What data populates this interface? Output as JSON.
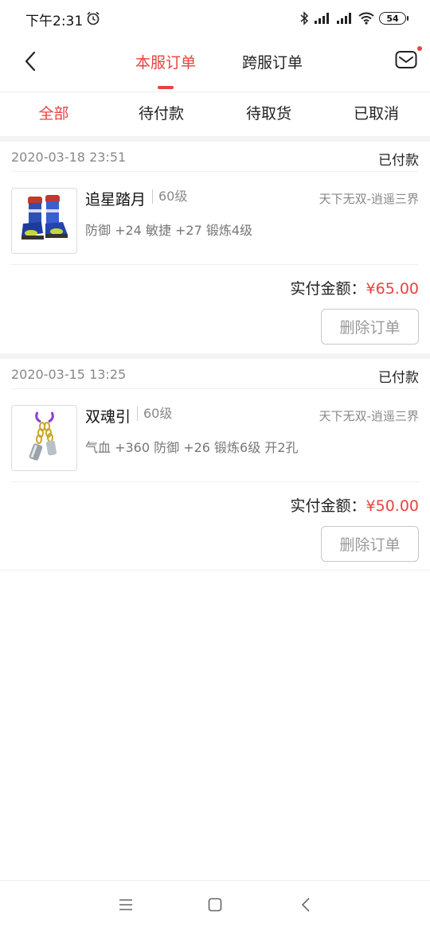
{
  "status_bar": {
    "time": "下午2:31",
    "battery": "54"
  },
  "header": {
    "tabs": [
      {
        "label": "本服订单",
        "active": true
      },
      {
        "label": "跨服订单",
        "active": false
      }
    ]
  },
  "filters": [
    {
      "label": "全部",
      "active": true
    },
    {
      "label": "待付款",
      "active": false
    },
    {
      "label": "待取货",
      "active": false
    },
    {
      "label": "已取消",
      "active": false
    }
  ],
  "orders": [
    {
      "date": "2020-03-18 23:51",
      "status": "已付款",
      "item_name": "追星踏月",
      "item_level": "60级",
      "server": "天下无双-逍遥三界",
      "attrs": "防御 +24 敏捷 +27 锻炼4级",
      "pay_label": "实付金额：",
      "pay_amount": "¥65.00",
      "delete_label": "删除订单",
      "icon": "boots-icon"
    },
    {
      "date": "2020-03-15 13:25",
      "status": "已付款",
      "item_name": "双魂引",
      "item_level": "60级",
      "server": "天下无双-逍遥三界",
      "attrs": "气血 +360 防御 +26 锻炼6级 开2孔",
      "pay_label": "实付金额：",
      "pay_amount": "¥50.00",
      "delete_label": "删除订单",
      "icon": "pendant-icon"
    }
  ],
  "colors": {
    "accent": "#e9423e",
    "muted": "#888888"
  }
}
